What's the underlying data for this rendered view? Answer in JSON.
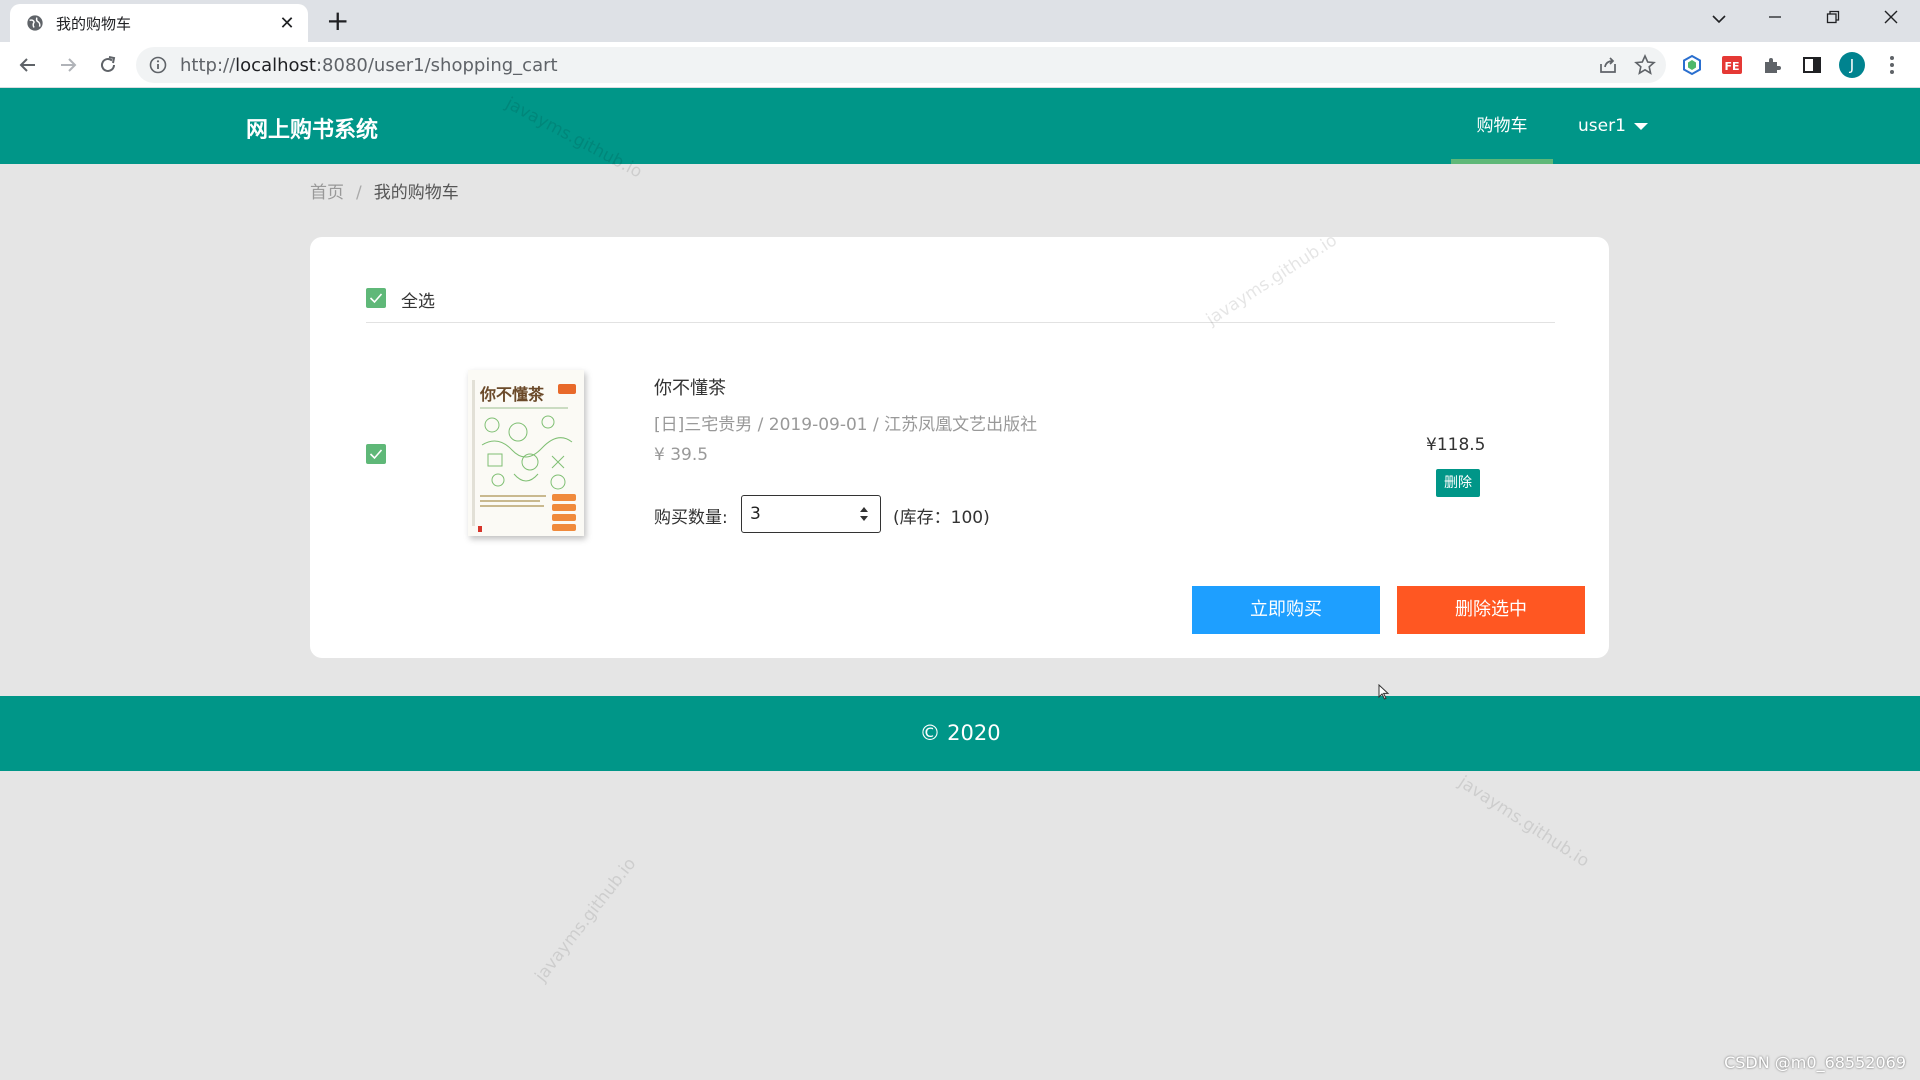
{
  "browser": {
    "tab_title": "我的购物车",
    "url_prefix": "http://",
    "url_host": "localhost",
    "url_rest": ":8080/user1/shopping_cart",
    "profile_initial": "J"
  },
  "header": {
    "logo": "网上购书系统",
    "nav_cart": "购物车",
    "nav_user": "user1"
  },
  "breadcrumb": {
    "home": "首页",
    "separator": "/",
    "current": "我的购物车"
  },
  "cart": {
    "select_all_label": "全选",
    "items": [
      {
        "title": "你不懂茶",
        "meta": "[日]三宅贵男 / 2019-09-01 / 江苏凤凰文艺出版社",
        "price": "¥ 39.5",
        "qty_label": "购买数量:",
        "qty": "3",
        "stock": "(库存：100)",
        "subtotal": "¥118.5",
        "delete_label": "删除",
        "cover_title": "你不懂茶",
        "checked": true
      }
    ],
    "buy_now_label": "立即购买",
    "delete_selected_label": "删除选中"
  },
  "footer": {
    "copyright": "© 2020"
  },
  "watermark_text": "javayms.github.io",
  "corner_credit": "CSDN @m0_68552069",
  "colors": {
    "primary": "#009688",
    "checkbox": "#5fb878",
    "buy_button": "#1e9fff",
    "delete_selected_button": "#ff5722"
  }
}
